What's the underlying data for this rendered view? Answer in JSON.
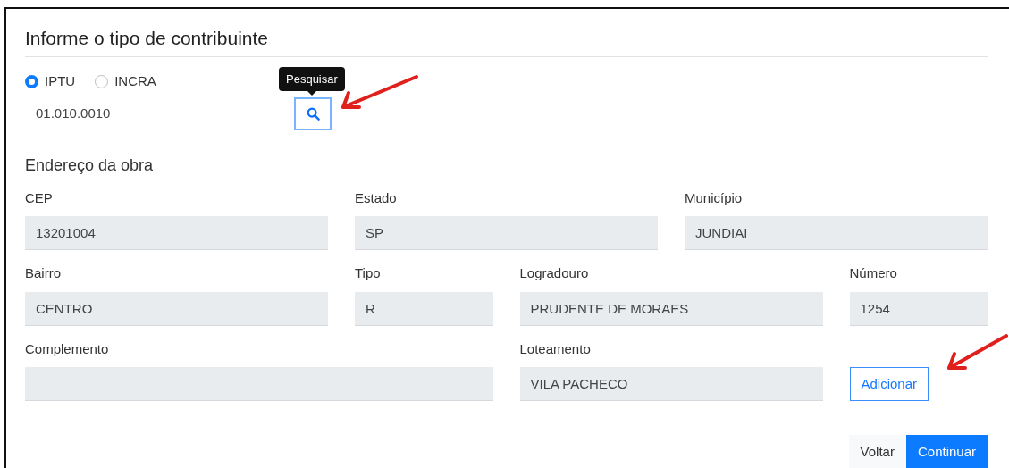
{
  "title": "Informe o tipo de contribuinte",
  "contributor_types": [
    {
      "label": "IPTU",
      "selected": true
    },
    {
      "label": "INCRA",
      "selected": false
    }
  ],
  "search": {
    "value": "01.010.0010",
    "tooltip": "Pesquisar"
  },
  "section_title": "Endereço da obra",
  "fields": [
    {
      "label": "CEP",
      "value": "13201004"
    },
    {
      "label": "Estado",
      "value": "SP"
    },
    {
      "label": "Município",
      "value": "JUNDIAI"
    },
    {
      "label": "Bairro",
      "value": "CENTRO"
    },
    {
      "label": "Tipo",
      "value": "R"
    },
    {
      "label": "Logradouro",
      "value": "PRUDENTE DE MORAES"
    },
    {
      "label": "Número",
      "value": "1254"
    },
    {
      "label": "Complemento"
    },
    {
      "label": "Loteamento",
      "value": "VILA PACHECO"
    }
  ],
  "add_button": "Adicionar",
  "actions": [
    {
      "label": "Voltar",
      "kind": "secondary"
    },
    {
      "label": "Continuar",
      "kind": "primary"
    }
  ],
  "annotations": [
    {
      "kind": "arrow"
    },
    {
      "kind": "arrow"
    }
  ]
}
